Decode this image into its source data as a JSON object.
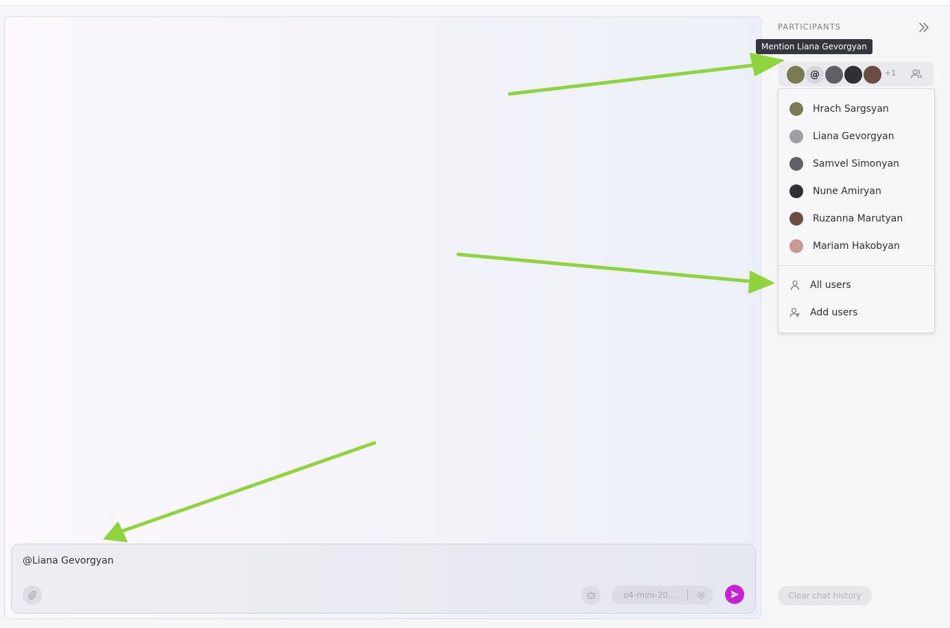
{
  "colors": {
    "accent": "#c623d8",
    "arrow": "#8fd43c",
    "tooltip_bg": "#35363d"
  },
  "chat": {
    "composer_value": "@Liana Gevorgyan",
    "attach_icon": "paperclip-icon",
    "bot_icon": "robot-icon",
    "model_label": "o4-mini-20...",
    "settings_icon": "gear-icon",
    "send_icon": "send-arrow-icon"
  },
  "sidebar": {
    "title": "PARTICIPANTS",
    "collapse_icon": "double-chevron-right-icon",
    "tooltip": "Mention Liana Gevorgyan",
    "mention_symbol": "@",
    "more_count": "+1",
    "group_icon": "users-icon",
    "participants": [
      {
        "name": "Hrach Sargsyan",
        "avatar_color": "#7a7b52"
      },
      {
        "name": "Liana Gevorgyan",
        "avatar_color": "#9ea0a6"
      },
      {
        "name": "Samvel Simonyan",
        "avatar_color": "#5e6066"
      },
      {
        "name": "Nune Amiryan",
        "avatar_color": "#2f3034"
      },
      {
        "name": "Ruzanna Marutyan",
        "avatar_color": "#6b4d44"
      },
      {
        "name": "Mariam Hakobyan",
        "avatar_color": "#c89a92"
      }
    ],
    "actions": [
      {
        "label": "All users",
        "icon": "user-icon"
      },
      {
        "label": "Add users",
        "icon": "user-plus-icon"
      }
    ],
    "clear_history": "Clear chat history"
  }
}
